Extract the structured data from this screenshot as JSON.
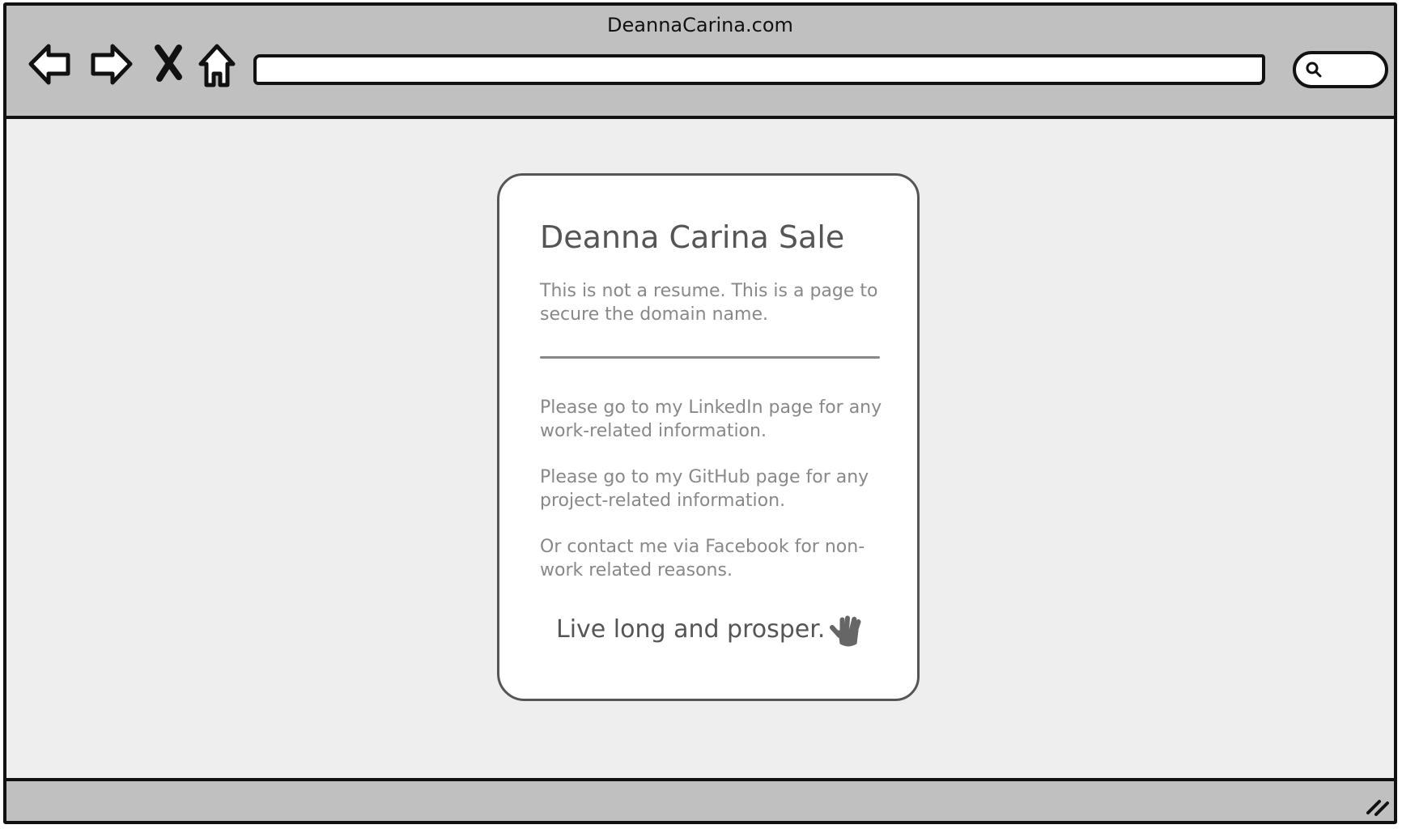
{
  "window": {
    "title": "DeannaCarina.com"
  },
  "toolbar": {
    "back_icon": "back-arrow-icon",
    "forward_icon": "forward-arrow-icon",
    "stop_icon": "close-x-icon",
    "home_icon": "home-icon",
    "address_value": "",
    "search_icon": "search-icon"
  },
  "card": {
    "title": "Deanna Carina Sale",
    "intro": "This is not a resume. This is a page to secure the domain name.",
    "linkedin": "Please go to my LinkedIn page for any work-related information.",
    "github": "Please go to my GitHub page for any project-related information.",
    "facebook": "Or contact me via Facebook for non-work related reasons.",
    "sign_off": "Live long and prosper.",
    "sign_off_icon": "vulcan-salute-hand-icon"
  },
  "statusbar": {
    "grip_icon": "resize-grip-icon"
  },
  "colors": {
    "chrome": "#c0c0c0",
    "page_background": "#eeeeee",
    "card_background": "#ffffff",
    "heading_text": "#555555",
    "body_text": "#888888",
    "outline": "#111111"
  }
}
